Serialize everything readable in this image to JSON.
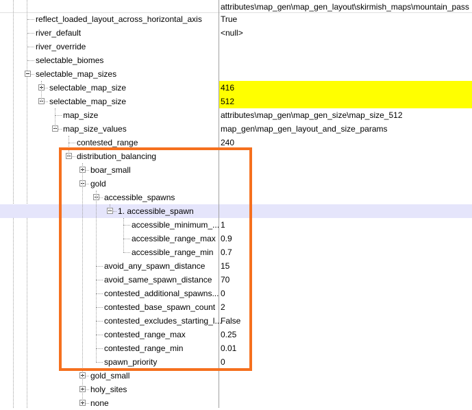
{
  "header": {
    "value": "attributes\\map_gen\\map_gen_layout\\skirmish_maps\\mountain_pass"
  },
  "rows": [
    {
      "label": "reflect_loaded_layout_across_horizontal_axis",
      "value": "True",
      "depth": 2,
      "expander": "none",
      "highlight": false,
      "selected": false
    },
    {
      "label": "river_default",
      "value": "<null>",
      "depth": 2,
      "expander": "none",
      "highlight": false,
      "selected": false
    },
    {
      "label": "river_override",
      "value": "",
      "depth": 2,
      "expander": "none",
      "highlight": false,
      "selected": false
    },
    {
      "label": "selectable_biomes",
      "value": "",
      "depth": 2,
      "expander": "none",
      "highlight": false,
      "selected": false
    },
    {
      "label": "selectable_map_sizes",
      "value": "",
      "depth": 2,
      "expander": "minus",
      "highlight": false,
      "selected": false
    },
    {
      "label": "selectable_map_size",
      "value": "416",
      "depth": 3,
      "expander": "plus",
      "highlight": true,
      "selected": false
    },
    {
      "label": "selectable_map_size",
      "value": "512",
      "depth": 3,
      "expander": "minus",
      "highlight": true,
      "selected": false
    },
    {
      "label": "map_size",
      "value": "attributes\\map_gen\\map_gen_size\\map_size_512",
      "depth": 4,
      "expander": "none",
      "highlight": false,
      "selected": false
    },
    {
      "label": "map_size_values",
      "value": "map_gen\\map_gen_layout_and_size_params",
      "depth": 4,
      "expander": "minus",
      "highlight": false,
      "selected": false
    },
    {
      "label": "contested_range",
      "value": "240",
      "depth": 5,
      "expander": "none",
      "highlight": false,
      "selected": false
    },
    {
      "label": "distribution_balancing",
      "value": "",
      "depth": 5,
      "expander": "minus",
      "highlight": false,
      "selected": false
    },
    {
      "label": "boar_small",
      "value": "",
      "depth": 6,
      "expander": "plus",
      "highlight": false,
      "selected": false
    },
    {
      "label": "gold",
      "value": "",
      "depth": 6,
      "expander": "minus",
      "highlight": false,
      "selected": false
    },
    {
      "label": "accessible_spawns",
      "value": "",
      "depth": 7,
      "expander": "minus",
      "highlight": false,
      "selected": false
    },
    {
      "label": "1. accessible_spawn",
      "value": "",
      "depth": 8,
      "expander": "minus",
      "highlight": false,
      "selected": true
    },
    {
      "label": "accessible_minimum_...",
      "value": "1",
      "depth": 9,
      "expander": "none",
      "highlight": false,
      "selected": false
    },
    {
      "label": "accessible_range_max",
      "value": "0.9",
      "depth": 9,
      "expander": "none",
      "highlight": false,
      "selected": false
    },
    {
      "label": "accessible_range_min",
      "value": "0.7",
      "depth": 9,
      "expander": "none",
      "highlight": false,
      "selected": false
    },
    {
      "label": "avoid_any_spawn_distance",
      "value": "15",
      "depth": 7,
      "expander": "none",
      "highlight": false,
      "selected": false
    },
    {
      "label": "avoid_same_spawn_distance",
      "value": "70",
      "depth": 7,
      "expander": "none",
      "highlight": false,
      "selected": false
    },
    {
      "label": "contested_additional_spawns...",
      "value": "0",
      "depth": 7,
      "expander": "none",
      "highlight": false,
      "selected": false
    },
    {
      "label": "contested_base_spawn_count",
      "value": "2",
      "depth": 7,
      "expander": "none",
      "highlight": false,
      "selected": false
    },
    {
      "label": "contested_excludes_starting_l...",
      "value": "False",
      "depth": 7,
      "expander": "none",
      "highlight": false,
      "selected": false
    },
    {
      "label": "contested_range_max",
      "value": "0.25",
      "depth": 7,
      "expander": "none",
      "highlight": false,
      "selected": false
    },
    {
      "label": "contested_range_min",
      "value": "0.01",
      "depth": 7,
      "expander": "none",
      "highlight": false,
      "selected": false
    },
    {
      "label": "spawn_priority",
      "value": "0",
      "depth": 7,
      "expander": "none",
      "highlight": false,
      "selected": false
    },
    {
      "label": "gold_small",
      "value": "",
      "depth": 6,
      "expander": "plus",
      "highlight": false,
      "selected": false
    },
    {
      "label": "holy_sites",
      "value": "",
      "depth": 6,
      "expander": "plus",
      "highlight": false,
      "selected": false
    },
    {
      "label": "none",
      "value": "",
      "depth": 6,
      "expander": "plus",
      "highlight": false,
      "selected": false
    }
  ],
  "colors": {
    "highlight": "#ffff00",
    "selected_row": "#e5e5fb",
    "annotation_box": "#f5701e",
    "divider": "#a0a0a0"
  },
  "icons": {
    "expand": "plus-box-icon",
    "collapse": "minus-box-icon"
  }
}
